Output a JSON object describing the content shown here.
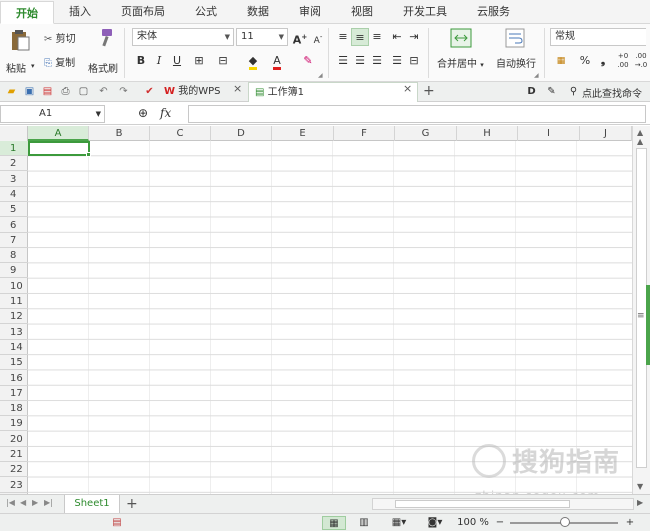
{
  "ribbon_tabs": [
    "开始",
    "插入",
    "页面布局",
    "公式",
    "数据",
    "审阅",
    "视图",
    "开发工具",
    "云服务"
  ],
  "clipboard": {
    "paste": "粘贴",
    "cut": "剪切",
    "copy": "复制",
    "format_painter": "格式刷"
  },
  "font": {
    "name": "宋体",
    "size": "11",
    "bold": "B",
    "italic": "I",
    "underline": "U",
    "font_color_glyph": "A",
    "grow": "A⁺",
    "shrink": "A⁻"
  },
  "alignment": {
    "merge_center": "合并居中",
    "wrap_text": "自动换行"
  },
  "number": {
    "format": "常规",
    "percent": "%",
    "comma": "❟",
    "inc_decimal": "+0 .00",
    "dec_decimal": ".00 →.0"
  },
  "doc_tabs": [
    {
      "label": "我的WPS"
    },
    {
      "label": "工作簿1"
    }
  ],
  "search_command": "点此查找命令",
  "formula_bar": {
    "cell_ref": "A1",
    "fx": "fx",
    "formula": ""
  },
  "columns": [
    "A",
    "B",
    "C",
    "D",
    "E",
    "F",
    "G",
    "H",
    "I",
    "J"
  ],
  "rows": [
    "1",
    "2",
    "3",
    "4",
    "5",
    "6",
    "7",
    "8",
    "9",
    "10",
    "11",
    "12",
    "13",
    "14",
    "15",
    "16",
    "17",
    "18",
    "19",
    "20",
    "21",
    "22",
    "23"
  ],
  "selected_cell": "A1",
  "sheets": [
    "Sheet1"
  ],
  "status": {
    "zoom": "100 %"
  },
  "watermark": {
    "brand": "搜狗指南",
    "url": "zhinan.sogou.com"
  },
  "colors": {
    "accent": "#2e8b2e",
    "selection": "#3c9a3c"
  }
}
